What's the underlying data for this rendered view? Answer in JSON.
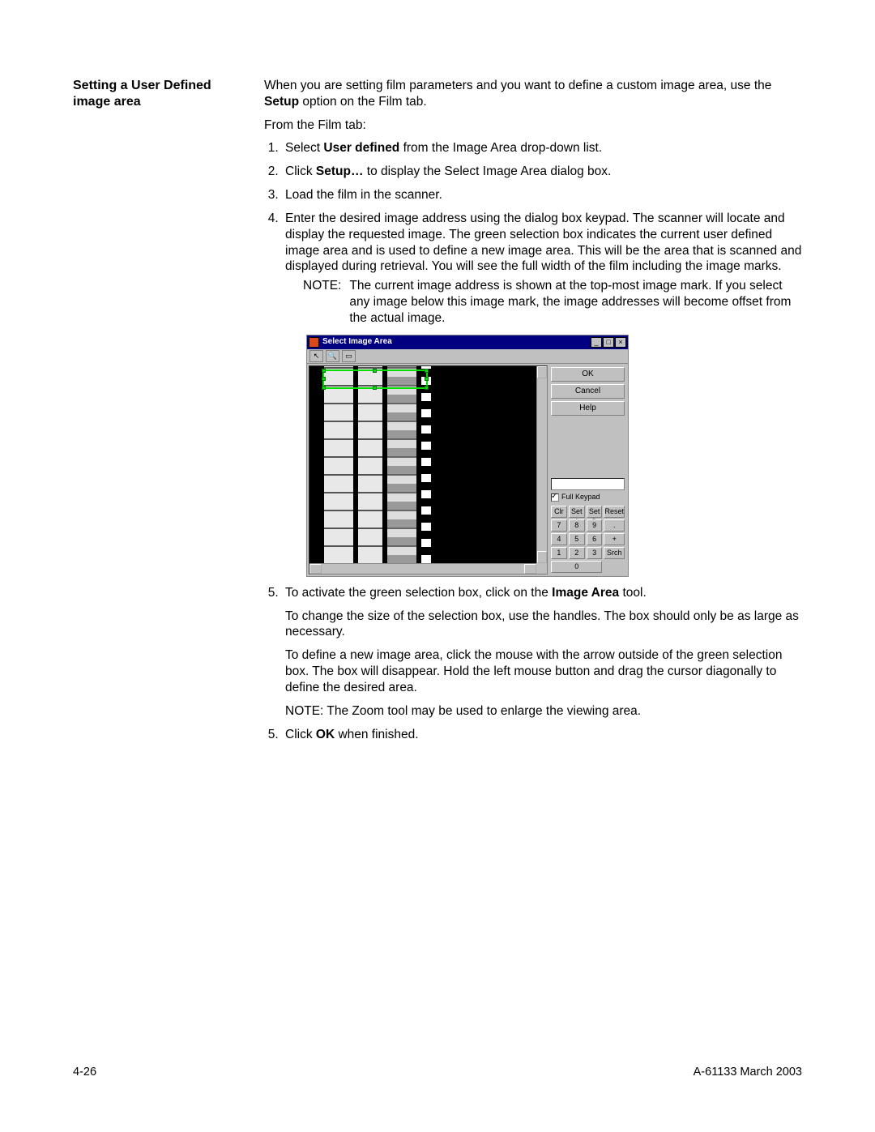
{
  "heading": "Setting a User Defined image area",
  "intro_pre": "When you are setting film parameters and you want to define a custom image area, use the ",
  "intro_bold": "Setup",
  "intro_post": " option on the Film tab.",
  "from": "From the Film tab:",
  "steps": {
    "s1_pre": "Select ",
    "s1_bold": "User defined",
    "s1_post": " from the Image Area drop-down list.",
    "s2_pre": "Click ",
    "s2_bold": "Setup…",
    "s2_post": " to display the Select Image Area dialog box.",
    "s3": "Load the film in the scanner.",
    "s4": "Enter the desired image address using the dialog box keypad.  The scanner will locate and display the requested image. The green selection box indicates the current user defined image area and is used to define a new image area. This will be the area that is scanned and displayed during retrieval. You will see the full width of the film including the image marks.",
    "note_label": "NOTE:",
    "note_body": "The current image address is shown at the top-most image mark. If you select any image below this image mark, the image addresses will become offset from the actual image.",
    "s5a_pre": "To activate the green selection box, click on the ",
    "s5a_bold": "Image Area",
    "s5a_post": " tool.",
    "s5b": "To change the size of the selection box, use the handles. The box should only be as large as necessary.",
    "s5c": "To define a new image area, click the mouse with the arrow outside of the green selection box. The box will disappear. Hold the left mouse button and drag the cursor diagonally to define the desired area.",
    "s5d": "NOTE:  The Zoom tool may be used to enlarge the viewing area.",
    "s5e_pre": "Click ",
    "s5e_bold": "OK",
    "s5e_post": " when finished."
  },
  "dialog": {
    "title": "Select Image Area",
    "btn_ok": "OK",
    "btn_cancel": "Cancel",
    "btn_help": "Help",
    "fullkey": "Full Keypad",
    "k_clr": "Clr",
    "k_seta": "Set A",
    "k_setb": "Set B",
    "k_reset": "Reset",
    "k7": "7",
    "k8": "8",
    "k9": "9",
    "kdot": ".",
    "k4": "4",
    "k5": "5",
    "k6": "6",
    "kplus": "+",
    "k1": "1",
    "k2": "2",
    "k3": "3",
    "ksrch": "Srch",
    "k0": "0"
  },
  "footer_left": "4-26",
  "footer_right": "A-61133  March 2003"
}
